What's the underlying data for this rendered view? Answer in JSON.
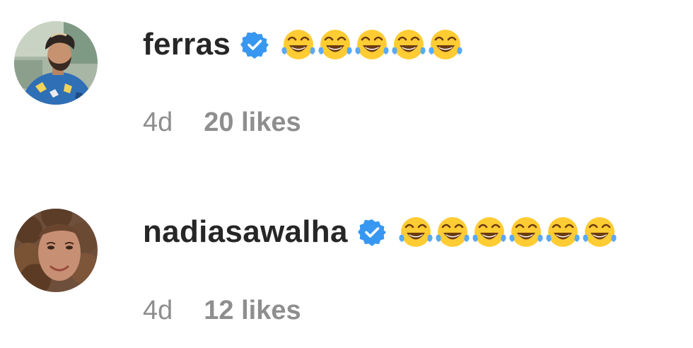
{
  "comments": [
    {
      "username": "ferras",
      "verified": true,
      "emojis": [
        "face-with-tears-of-joy",
        "face-with-tears-of-joy",
        "face-with-tears-of-joy",
        "face-with-tears-of-joy",
        "face-with-tears-of-joy"
      ],
      "time": "4d",
      "likes": "20 likes"
    },
    {
      "username": "nadiasawalha",
      "verified": true,
      "emojis": [
        "face-with-tears-of-joy",
        "face-with-tears-of-joy",
        "face-with-tears-of-joy",
        "face-with-tears-of-joy",
        "face-with-tears-of-joy",
        "face-with-tears-of-joy"
      ],
      "time": "4d",
      "likes": "12 likes"
    }
  ],
  "colors": {
    "username": "#262626",
    "meta": "#8e8e8e",
    "verified_badge": "#3897f0",
    "emoji_face": "#ffcc33",
    "emoji_tear": "#5aa9f5"
  }
}
